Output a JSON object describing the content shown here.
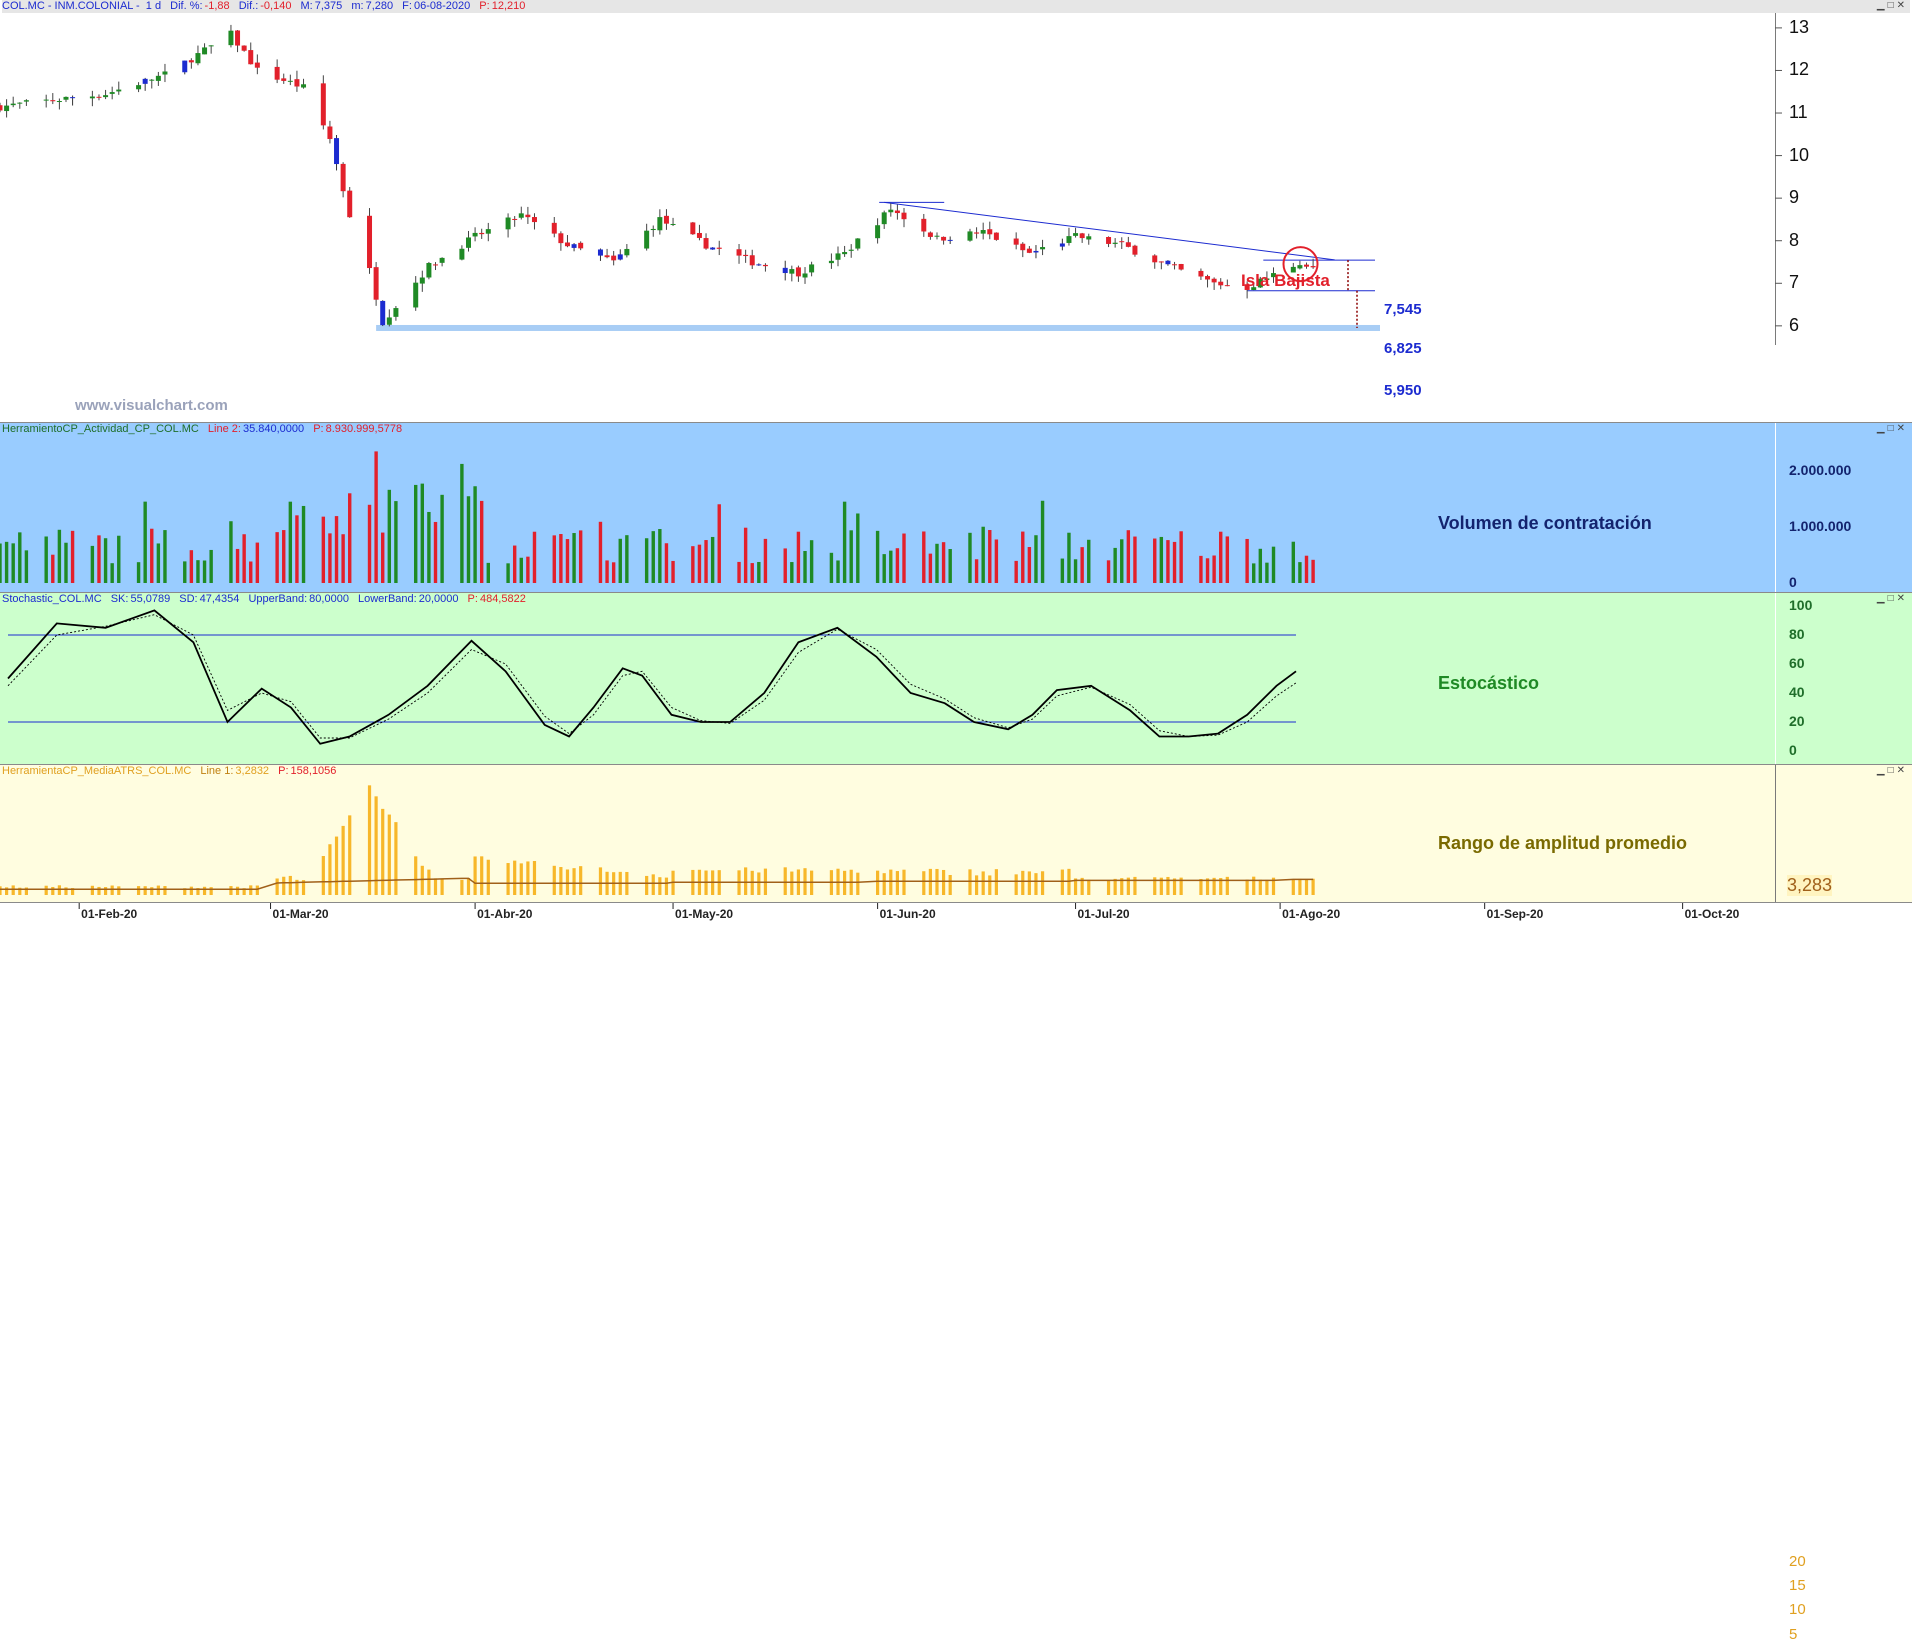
{
  "colors": {
    "bull": "#1f8a25",
    "bear": "#e2202b",
    "neutral": "#1c2bd0",
    "trend": "#1c2bd0",
    "support": "#a8cdf5",
    "vol_bg": "#99ccff",
    "stoch_bg": "#ccffcc",
    "atr_bg": "#fffde0",
    "atr_bar": "#f7b72a",
    "atr_line": "#a0601a"
  },
  "watermark": "www.visualchart.com",
  "price_panel": {
    "header": {
      "symbol": "COL.MC - INM.COLONIAL -",
      "period": "1 d",
      "dif_pct_label": "Dif. %:",
      "dif_pct": "-1,88",
      "dif_label": "Dif.:",
      "dif": "-0,140",
      "max_label": "M:",
      "max": "7,375",
      "min_label": "m:",
      "min": "7,280",
      "date_label": "F:",
      "date": "06-08-2020",
      "p_label": "P:",
      "p": "12,210"
    },
    "yticks": [
      "13",
      "12",
      "11",
      "10",
      "9",
      "8",
      "7",
      "6"
    ],
    "annotation": "Isla Bajista",
    "levels": [
      {
        "label": "7,545",
        "value": 7.545
      },
      {
        "label": "6,825",
        "value": 6.825
      },
      {
        "label": "5,950",
        "value": 5.95
      }
    ]
  },
  "xticks": [
    "01-Feb-20",
    "01-Mar-20",
    "01-Abr-20",
    "01-May-20",
    "01-Jun-20",
    "01-Jul-20",
    "01-Ago-20",
    "01-Sep-20",
    "01-Oct-20"
  ],
  "volume_panel": {
    "header": {
      "name": "HerramientoCP_Actividad_CP_COL.MC",
      "line_label": "Line 2:",
      "line": "35.840,0000",
      "p_label": "P:",
      "p": "8.930.999,5778"
    },
    "title": "Volumen de contratación",
    "yticks": [
      "2.000.000",
      "1.000.000",
      "0"
    ]
  },
  "stoch_panel": {
    "header": {
      "name": "Stochastic_COL.MC",
      "sk_label": "SK:",
      "sk": "55,0789",
      "sd_label": "SD:",
      "sd": "47,4354",
      "ub_label": "UpperBand:",
      "ub": "80,0000",
      "lb_label": "LowerBand:",
      "lb": "20,0000",
      "p_label": "P:",
      "p": "484,5822"
    },
    "title": "Estocástico",
    "yticks": [
      "100",
      "80",
      "60",
      "40",
      "20",
      "0"
    ]
  },
  "atr_panel": {
    "header": {
      "name": "HerramientaCP_MediaATRS_COL.MC",
      "line_label": "Line 1:",
      "line": "3,2832",
      "p_label": "P:",
      "p": "158,1056"
    },
    "title": "Rango de amplitud promedio",
    "yticks": [
      "20",
      "15",
      "10",
      "5"
    ],
    "last_value": "3,283"
  },
  "chart_data": [
    {
      "type": "candlestick",
      "title": "COL.MC - INM.COLONIAL",
      "x_range": [
        "2020-01-20",
        "2020-10-15"
      ],
      "ylim": [
        5.55,
        13.35
      ],
      "anchors": [
        {
          "date": "2020-01-20",
          "close": 11.15
        },
        {
          "date": "2020-02-05",
          "close": 11.45
        },
        {
          "date": "2020-02-14",
          "close": 11.9
        },
        {
          "date": "2020-02-24",
          "close": 12.85
        },
        {
          "date": "2020-02-28",
          "close": 12.0
        },
        {
          "date": "2020-03-06",
          "close": 11.6
        },
        {
          "date": "2020-03-10",
          "close": 10.4
        },
        {
          "date": "2020-03-13",
          "close": 8.6
        },
        {
          "date": "2020-03-16",
          "close": 7.3
        },
        {
          "date": "2020-03-18",
          "close": 6.1
        },
        {
          "date": "2020-03-25",
          "close": 7.4
        },
        {
          "date": "2020-04-01",
          "close": 8.1
        },
        {
          "date": "2020-04-08",
          "close": 8.6
        },
        {
          "date": "2020-04-15",
          "close": 7.9
        },
        {
          "date": "2020-04-22",
          "close": 7.5
        },
        {
          "date": "2020-04-29",
          "close": 8.5
        },
        {
          "date": "2020-05-06",
          "close": 7.9
        },
        {
          "date": "2020-05-13",
          "close": 7.5
        },
        {
          "date": "2020-05-20",
          "close": 7.25
        },
        {
          "date": "2020-05-27",
          "close": 7.7
        },
        {
          "date": "2020-06-03",
          "close": 8.75
        },
        {
          "date": "2020-06-10",
          "close": 8.05
        },
        {
          "date": "2020-06-17",
          "close": 8.2
        },
        {
          "date": "2020-06-24",
          "close": 7.7
        },
        {
          "date": "2020-07-01",
          "close": 8.1
        },
        {
          "date": "2020-07-08",
          "close": 7.9
        },
        {
          "date": "2020-07-15",
          "close": 7.4
        },
        {
          "date": "2020-07-22",
          "close": 7.0
        },
        {
          "date": "2020-07-27",
          "close": 6.9
        },
        {
          "date": "2020-07-31",
          "close": 7.2
        },
        {
          "date": "2020-08-04",
          "close": 7.5
        },
        {
          "date": "2020-08-06",
          "close": 7.33
        }
      ],
      "trendline": [
        {
          "date": "2020-06-02",
          "value": 8.9
        },
        {
          "date": "2020-08-07",
          "value": 7.55
        }
      ],
      "horizontal_levels": [
        7.545,
        6.825,
        5.95
      ]
    },
    {
      "type": "bar",
      "title": "Volumen de contratación",
      "ylim": [
        0,
        2500000
      ],
      "typical_range": [
        350000,
        2400000
      ]
    },
    {
      "type": "line",
      "title": "Estocástico",
      "ylim": [
        0,
        100
      ],
      "bands": [
        80,
        20
      ],
      "series": [
        {
          "name": "SK",
          "points": [
            [
              0,
              50
            ],
            [
              10,
              88
            ],
            [
              20,
              85
            ],
            [
              30,
              97
            ],
            [
              38,
              75
            ],
            [
              45,
              20
            ],
            [
              52,
              43
            ],
            [
              58,
              30
            ],
            [
              64,
              5
            ],
            [
              70,
              10
            ],
            [
              78,
              25
            ],
            [
              86,
              45
            ],
            [
              95,
              76
            ],
            [
              102,
              55
            ],
            [
              110,
              18
            ],
            [
              115,
              10
            ],
            [
              120,
              30
            ],
            [
              126,
              57
            ],
            [
              130,
              52
            ],
            [
              136,
              25
            ],
            [
              142,
              20
            ],
            [
              148,
              20
            ],
            [
              155,
              40
            ],
            [
              162,
              75
            ],
            [
              170,
              85
            ],
            [
              178,
              65
            ],
            [
              185,
              40
            ],
            [
              192,
              33
            ],
            [
              198,
              20
            ],
            [
              205,
              15
            ],
            [
              210,
              25
            ],
            [
              215,
              42
            ],
            [
              222,
              45
            ],
            [
              230,
              28
            ],
            [
              236,
              10
            ],
            [
              242,
              10
            ],
            [
              248,
              12
            ],
            [
              254,
              25
            ],
            [
              260,
              45
            ],
            [
              264,
              55
            ]
          ]
        },
        {
          "name": "SD",
          "points": [
            [
              0,
              45
            ],
            [
              10,
              80
            ],
            [
              20,
              86
            ],
            [
              30,
              94
            ],
            [
              38,
              80
            ],
            [
              45,
              28
            ],
            [
              52,
              40
            ],
            [
              58,
              34
            ],
            [
              64,
              9
            ],
            [
              70,
              9
            ],
            [
              78,
              22
            ],
            [
              86,
              40
            ],
            [
              95,
              70
            ],
            [
              102,
              60
            ],
            [
              110,
              24
            ],
            [
              115,
              12
            ],
            [
              120,
              25
            ],
            [
              126,
              52
            ],
            [
              130,
              55
            ],
            [
              136,
              30
            ],
            [
              142,
              21
            ],
            [
              148,
              19
            ],
            [
              155,
              35
            ],
            [
              162,
              68
            ],
            [
              170,
              84
            ],
            [
              178,
              70
            ],
            [
              185,
              46
            ],
            [
              192,
              36
            ],
            [
              198,
              23
            ],
            [
              205,
              16
            ],
            [
              210,
              22
            ],
            [
              215,
              38
            ],
            [
              222,
              44
            ],
            [
              230,
              32
            ],
            [
              236,
              14
            ],
            [
              242,
              10
            ],
            [
              248,
              11
            ],
            [
              254,
              20
            ],
            [
              260,
              38
            ],
            [
              264,
              47
            ]
          ]
        }
      ]
    },
    {
      "type": "bar",
      "title": "Rango de amplitud promedio",
      "ylim": [
        0,
        24
      ],
      "last": 3.283,
      "peaks": [
        {
          "date": "2020-03-16",
          "value": 21.5
        },
        {
          "date": "2020-03-25",
          "value": 15
        },
        {
          "date": "2020-04-08",
          "value": 6
        },
        {
          "date": "2020-08-06",
          "value": 3.28
        }
      ]
    }
  ]
}
